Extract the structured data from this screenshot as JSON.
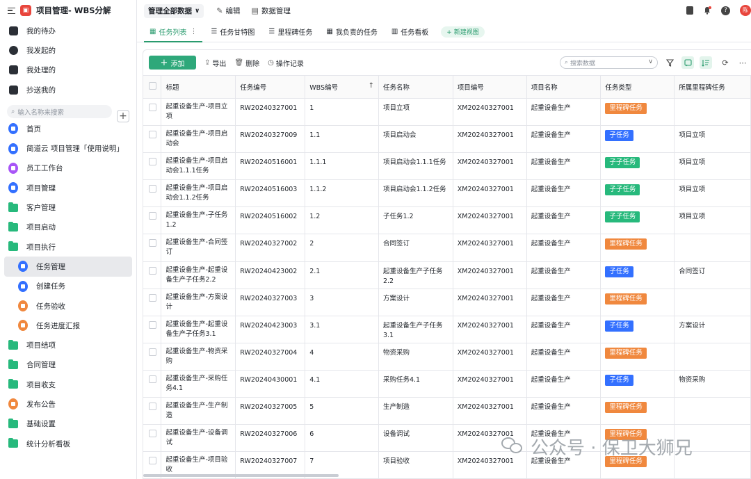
{
  "app": {
    "title": "项目管理- WBS分解",
    "logo_glyph": "▣"
  },
  "sidebar": {
    "top_items": [
      {
        "label": "我的待办",
        "icon": "bell-icon"
      },
      {
        "label": "我发起的",
        "icon": "play-icon"
      },
      {
        "label": "我处理的",
        "icon": "check-box-icon"
      },
      {
        "label": "抄送我的",
        "icon": "send-icon"
      }
    ],
    "search_placeholder": "输入名称来搜索",
    "add_label": "+",
    "nav": [
      {
        "label": "首页",
        "icon": "home-icon",
        "type": "circle",
        "color": "#3370ff"
      },
      {
        "label": "简道云 项目管理「使用说明」",
        "icon": "document-icon",
        "type": "circle",
        "color": "#3370ff"
      },
      {
        "label": "员工工作台",
        "icon": "user-icon",
        "type": "circle",
        "color": "#a855f7"
      },
      {
        "label": "项目管理",
        "icon": "document-icon",
        "type": "circle",
        "color": "#3370ff"
      },
      {
        "label": "客户管理",
        "icon": "folder-icon",
        "type": "folder"
      },
      {
        "label": "项目启动",
        "icon": "folder-icon",
        "type": "folder"
      },
      {
        "label": "项目执行",
        "icon": "folder-open-icon",
        "type": "folder"
      },
      {
        "label": "任务管理",
        "icon": "chart-icon",
        "type": "circle",
        "color": "#3370ff",
        "sub": true,
        "active": true
      },
      {
        "label": "创建任务",
        "icon": "send-icon",
        "type": "circle",
        "color": "#3370ff",
        "sub": true
      },
      {
        "label": "任务验收",
        "icon": "shield-icon",
        "type": "circle",
        "color": "#f0883e",
        "sub": true
      },
      {
        "label": "任务进度汇报",
        "icon": "shield-icon",
        "type": "circle",
        "color": "#f0883e",
        "sub": true
      },
      {
        "label": "项目结项",
        "icon": "folder-icon",
        "type": "folder"
      },
      {
        "label": "合同管理",
        "icon": "folder-icon",
        "type": "folder"
      },
      {
        "label": "项目收支",
        "icon": "folder-icon",
        "type": "folder"
      },
      {
        "label": "发布公告",
        "icon": "upload-icon",
        "type": "circle",
        "color": "#f0883e"
      },
      {
        "label": "基础设置",
        "icon": "folder-icon",
        "type": "folder"
      },
      {
        "label": "统计分析看板",
        "icon": "folder-icon",
        "type": "folder"
      }
    ]
  },
  "topbar": {
    "data_select": "管理全部数据",
    "edit_label": "编辑",
    "data_manage_label": "数据管理",
    "avatar_text": "陈"
  },
  "tabs": [
    {
      "label": "任务列表",
      "icon": "table-icon",
      "active": true,
      "more": "⋮"
    },
    {
      "label": "任务甘特图",
      "icon": "gantt-icon"
    },
    {
      "label": "里程碑任务",
      "icon": "gantt-icon"
    },
    {
      "label": "我负责的任务",
      "icon": "table-icon"
    },
    {
      "label": "任务看板",
      "icon": "kanban-icon"
    }
  ],
  "new_view_label": "+ 新建视图",
  "toolbar": {
    "add_label": "添加",
    "export_label": "导出",
    "delete_label": "删除",
    "log_label": "操作记录",
    "search_placeholder": "搜索数据"
  },
  "table": {
    "columns": [
      "标题",
      "任务编号",
      "WBS编号",
      "任务名称",
      "项目编号",
      "项目名称",
      "任务类型",
      "所属里程碑任务"
    ],
    "sort_icon": "↑",
    "rows": [
      {
        "title": "起重设备生产-项目立项",
        "task_no": "RW20240327001",
        "wbs": "1",
        "name": "项目立项",
        "project_no": "XM20240327001",
        "project_name": "起重设备生产",
        "type": "里程碑任务",
        "milestone": ""
      },
      {
        "title": "起重设备生产-项目启动会",
        "task_no": "RW20240327009",
        "wbs": "1.1",
        "name": "项目启动会",
        "project_no": "XM20240327001",
        "project_name": "起重设备生产",
        "type": "子任务",
        "milestone": "项目立项"
      },
      {
        "title": "起重设备生产-项目启动会1.1.1任务",
        "task_no": "RW20240516001",
        "wbs": "1.1.1",
        "name": "项目启动会1.1.1任务",
        "project_no": "XM20240327001",
        "project_name": "起重设备生产",
        "type": "子子任务",
        "milestone": "项目立项"
      },
      {
        "title": "起重设备生产-项目启动会1.1.2任务",
        "task_no": "RW20240516003",
        "wbs": "1.1.2",
        "name": "项目启动会1.1.2任务",
        "project_no": "XM20240327001",
        "project_name": "起重设备生产",
        "type": "子子任务",
        "milestone": "项目立项"
      },
      {
        "title": "起重设备生产-子任务1.2",
        "task_no": "RW20240516002",
        "wbs": "1.2",
        "name": "子任务1.2",
        "project_no": "XM20240327001",
        "project_name": "起重设备生产",
        "type": "子子任务",
        "milestone": "项目立项"
      },
      {
        "title": "起重设备生产-合同签订",
        "task_no": "RW20240327002",
        "wbs": "2",
        "name": "合同签订",
        "project_no": "XM20240327001",
        "project_name": "起重设备生产",
        "type": "里程碑任务",
        "milestone": ""
      },
      {
        "title": "起重设备生产-起重设备生产子任务2.2",
        "task_no": "RW20240423002",
        "wbs": "2.1",
        "name": "起重设备生产子任务2.2",
        "project_no": "XM20240327001",
        "project_name": "起重设备生产",
        "type": "子任务",
        "milestone": "合同签订"
      },
      {
        "title": "起重设备生产-方案设计",
        "task_no": "RW20240327003",
        "wbs": "3",
        "name": "方案设计",
        "project_no": "XM20240327001",
        "project_name": "起重设备生产",
        "type": "里程碑任务",
        "milestone": ""
      },
      {
        "title": "起重设备生产-起重设备生产子任务3.1",
        "task_no": "RW20240423003",
        "wbs": "3.1",
        "name": "起重设备生产子任务3.1",
        "project_no": "XM20240327001",
        "project_name": "起重设备生产",
        "type": "子任务",
        "milestone": "方案设计"
      },
      {
        "title": "起重设备生产-物资采购",
        "task_no": "RW20240327004",
        "wbs": "4",
        "name": "物资采购",
        "project_no": "XM20240327001",
        "project_name": "起重设备生产",
        "type": "里程碑任务",
        "milestone": ""
      },
      {
        "title": "起重设备生产-采购任务4.1",
        "task_no": "RW20240430001",
        "wbs": "4.1",
        "name": "采购任务4.1",
        "project_no": "XM20240327001",
        "project_name": "起重设备生产",
        "type": "子任务",
        "milestone": "物资采购"
      },
      {
        "title": "起重设备生产-生产制造",
        "task_no": "RW20240327005",
        "wbs": "5",
        "name": "生产制造",
        "project_no": "XM20240327001",
        "project_name": "起重设备生产",
        "type": "里程碑任务",
        "milestone": ""
      },
      {
        "title": "起重设备生产-设备调试",
        "task_no": "RW20240327006",
        "wbs": "6",
        "name": "设备调试",
        "project_no": "XM20240327001",
        "project_name": "起重设备生产",
        "type": "里程碑任务",
        "milestone": ""
      },
      {
        "title": "起重设备生产-项目验收",
        "task_no": "RW20240327007",
        "wbs": "7",
        "name": "项目验收",
        "project_no": "XM20240327001",
        "project_name": "起重设备生产",
        "type": "里程碑任务",
        "milestone": ""
      }
    ]
  },
  "type_colors": {
    "里程碑任务": "#f0883e",
    "子任务": "#3370ff",
    "子子任务": "#27b97c"
  },
  "watermark": {
    "text": "公众号 · 保卫大狮兄",
    "icon": "wechat-icon"
  }
}
